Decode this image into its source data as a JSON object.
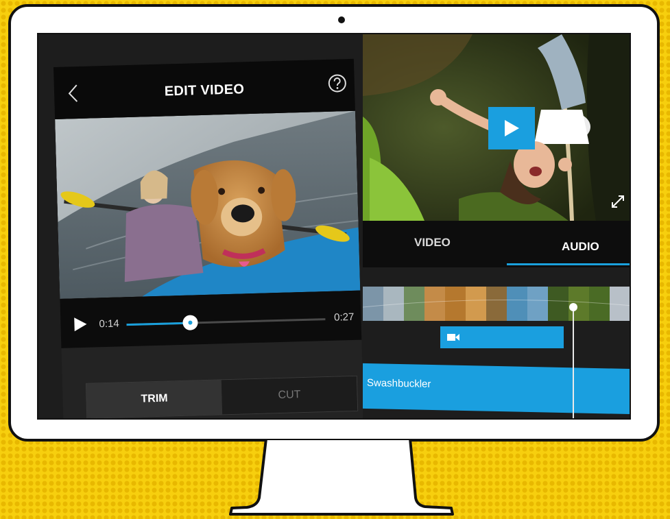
{
  "edit_screen": {
    "title": "EDIT VIDEO",
    "back_icon": "chevron-left-icon",
    "help_icon": "question-circle-icon",
    "player": {
      "current_time": "0:14",
      "total_time": "0:27",
      "progress_fraction": 0.32
    },
    "mode_tabs": {
      "trim_label": "TRIM",
      "cut_label": "CUT",
      "selected": "TRIM"
    }
  },
  "editor_screen": {
    "tabs": {
      "video_label": "VIDEO",
      "audio_label": "AUDIO",
      "selected": "AUDIO"
    },
    "audio_track_name": "Swashbuckler",
    "colors": {
      "accent": "#1a9fdf",
      "background": "#1b1b1b"
    }
  },
  "frame": {
    "background_color": "#f7cf0e",
    "monitor_color": "#ffffff"
  }
}
